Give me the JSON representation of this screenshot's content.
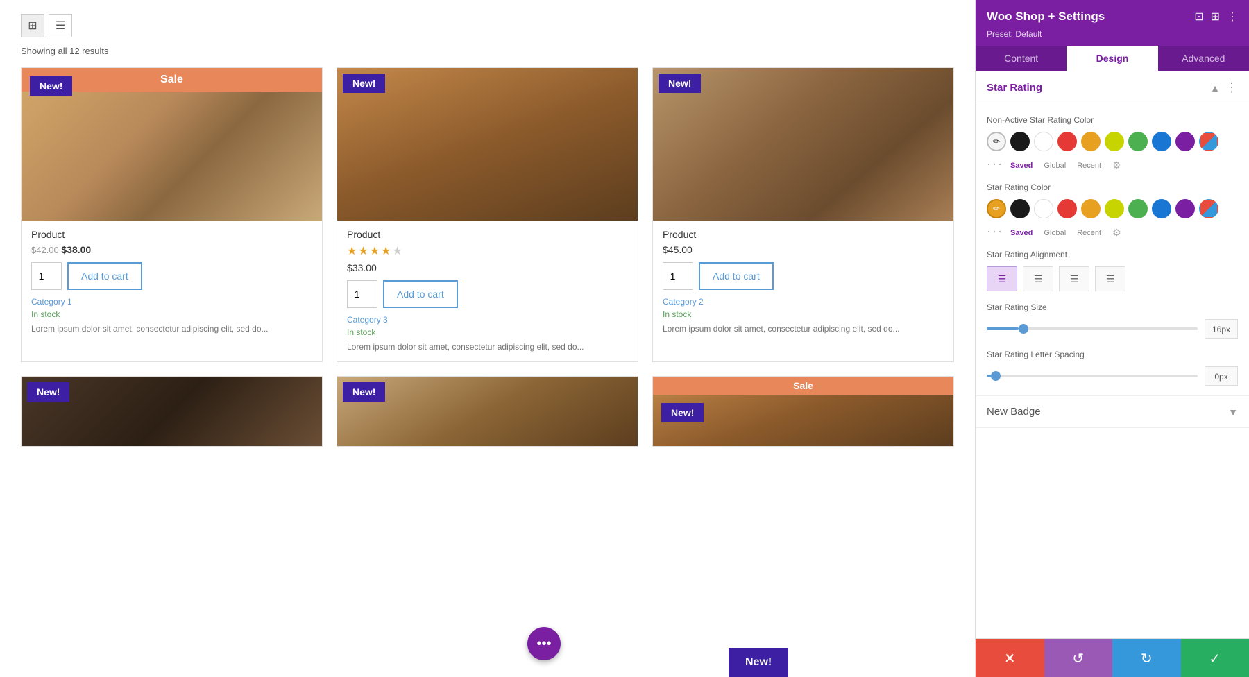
{
  "page": {
    "title": "Woo Shop + Settings"
  },
  "toolbar": {
    "results": "Showing all 12 results"
  },
  "products": [
    {
      "id": 1,
      "name": "Product",
      "has_sale_banner": true,
      "sale_text": "Sale",
      "has_new_badge": true,
      "new_badge_text": "New!",
      "image_class": "img-placeholder-1",
      "has_rating": false,
      "price_old": "$42.00",
      "price_new": "$38.00",
      "qty": 1,
      "add_to_cart": "Add to cart",
      "category": "Category 1",
      "in_stock": "In stock",
      "desc": "Lorem ipsum dolor sit amet, consectetur adipiscing elit, sed do..."
    },
    {
      "id": 2,
      "name": "Product",
      "has_sale_banner": false,
      "sale_text": "",
      "has_new_badge": true,
      "new_badge_text": "New!",
      "image_class": "img-placeholder-2",
      "has_rating": true,
      "stars_active": 4,
      "stars_total": 5,
      "price_old": "",
      "price_new": "$33.00",
      "qty": 1,
      "add_to_cart": "Add to cart",
      "category": "Category 3",
      "in_stock": "In stock",
      "desc": "Lorem ipsum dolor sit amet, consectetur adipiscing elit, sed do..."
    },
    {
      "id": 3,
      "name": "Product",
      "has_sale_banner": false,
      "sale_text": "",
      "has_new_badge": true,
      "new_badge_text": "New!",
      "image_class": "img-placeholder-3",
      "has_rating": false,
      "price_old": "",
      "price_new": "$45.00",
      "qty": 1,
      "add_to_cart": "Add to cart",
      "category": "Category 2",
      "in_stock": "In stock",
      "desc": "Lorem ipsum dolor sit amet, consectetur adipiscing elit, sed do..."
    }
  ],
  "bottom_products": [
    {
      "id": 4,
      "image_class": "img-placeholder-4",
      "has_new_badge": true,
      "new_badge_text": "New!",
      "has_sale_banner": false
    },
    {
      "id": 5,
      "image_class": "img-placeholder-5",
      "has_new_badge": true,
      "new_badge_text": "New!",
      "has_sale_banner": false
    },
    {
      "id": 6,
      "image_class": "img-placeholder-3",
      "has_new_badge": false,
      "has_sale_banner": true,
      "sale_text": "Sale",
      "new_badge_text": "New!"
    }
  ],
  "panel": {
    "title": "Woo Shop + Settings",
    "preset": "Preset: Default",
    "tabs": [
      "Content",
      "Design",
      "Advanced"
    ],
    "active_tab": "Design",
    "section_star_rating": {
      "title": "Star Rating",
      "non_active_label": "Non-Active Star Rating Color",
      "active_label": "Star Rating Color",
      "alignment_label": "Star Rating Alignment",
      "size_label": "Star Rating Size",
      "size_value": "16px",
      "size_percent": 15,
      "letter_spacing_label": "Star Rating Letter Spacing",
      "letter_spacing_value": "0px",
      "letter_spacing_percent": 2,
      "saved_label": "Saved",
      "global_label": "Global",
      "recent_label": "Recent"
    },
    "section_new_badge": {
      "title": "New Badge"
    },
    "action_bar": {
      "cancel": "✕",
      "undo": "↺",
      "redo": "↻",
      "confirm": "✓"
    }
  },
  "colors": {
    "non_active_swatches": [
      "#f5f5f5",
      "#1a1a1a",
      "#ffffff",
      "#e53935",
      "#e8a020",
      "#c8d400",
      "#4caf50",
      "#1976d2",
      "#7b1fa2"
    ],
    "active_swatches": [
      "#e8a020",
      "#1a1a1a",
      "#ffffff",
      "#e53935",
      "#e8a020",
      "#c8d400",
      "#4caf50",
      "#1976d2",
      "#7b1fa2"
    ],
    "non_active_selected_index": 0,
    "active_selected_index": 0
  },
  "fab": {
    "icon": "•••"
  },
  "new_badge_preview": {
    "text": "New!"
  }
}
